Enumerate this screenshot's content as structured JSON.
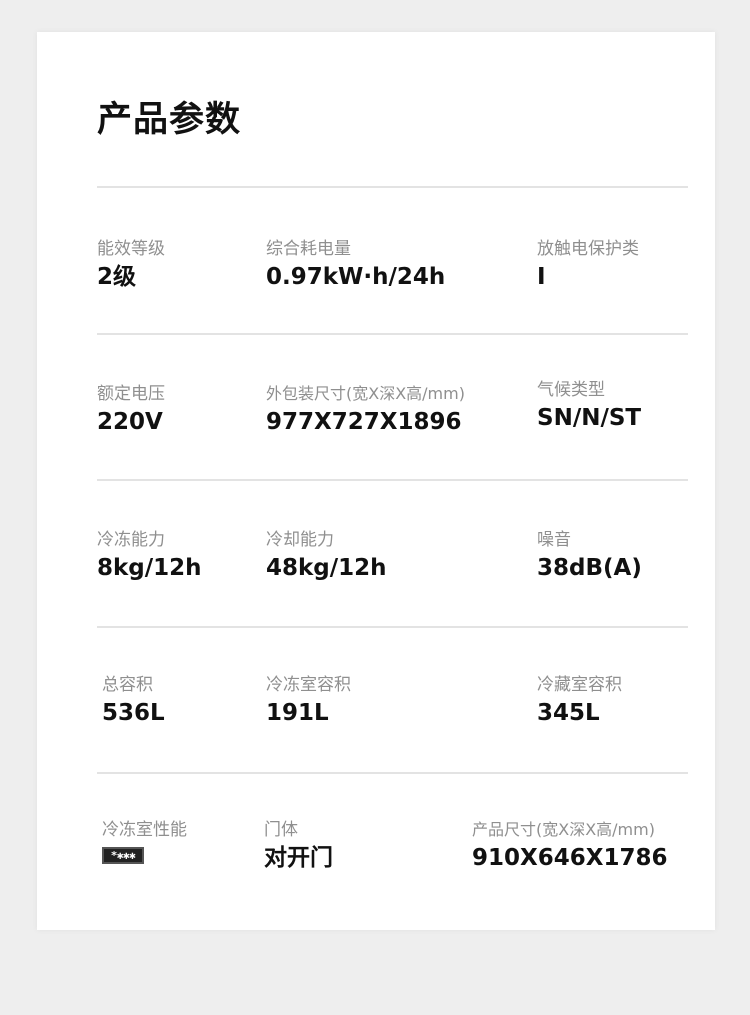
{
  "title": "产品参数",
  "specs": [
    {
      "label": "能效等级",
      "value": "2级"
    },
    {
      "label": "综合耗电量",
      "value": "0.97kW·h/24h"
    },
    {
      "label": "放触电保护类",
      "value": "I"
    },
    {
      "label": "额定电压",
      "value": "220V"
    },
    {
      "label": "外包装尺寸(宽X深X高/mm)",
      "value": "977X727X1896"
    },
    {
      "label": "气候类型",
      "value": "SN/N/ST"
    },
    {
      "label": "冷冻能力",
      "value": "8kg/12h"
    },
    {
      "label": "冷却能力",
      "value": "48kg/12h"
    },
    {
      "label": "噪音",
      "value": "38dB(A)"
    },
    {
      "label": "总容积",
      "value": "536L"
    },
    {
      "label": "冷冻室容积",
      "value": "191L"
    },
    {
      "label": "冷藏室容积",
      "value": "345L"
    },
    {
      "label": "冷冻室性能",
      "value": "*✱✱✱"
    },
    {
      "label": "门体",
      "value": "对开门"
    },
    {
      "label": "产品尺寸(宽X深X高/mm)",
      "value": "910X646X1786"
    }
  ]
}
